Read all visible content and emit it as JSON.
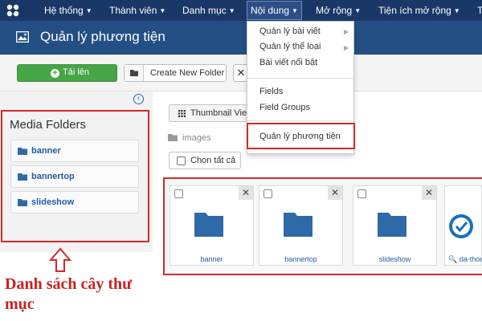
{
  "navbar": {
    "items": [
      {
        "label": "Hệ thống"
      },
      {
        "label": "Thành viên"
      },
      {
        "label": "Danh mục"
      },
      {
        "label": "Nội dung"
      },
      {
        "label": "Mở rộng"
      },
      {
        "label": "Tiện ích mở rộng"
      },
      {
        "label": "T"
      }
    ]
  },
  "header": {
    "title": "Quản lý phương tiện"
  },
  "toolbar": {
    "upload_label": "Tải lên",
    "new_folder_label": "Create New Folder"
  },
  "dropdown": {
    "items": [
      {
        "label": "Quản lý bài viết",
        "has_submenu": true
      },
      {
        "label": "Quản lý thể loại",
        "has_submenu": true
      },
      {
        "label": "Bài viết nổi bật",
        "has_submenu": false
      },
      {
        "label": "Fields",
        "has_submenu": false
      },
      {
        "label": "Field Groups",
        "has_submenu": false
      },
      {
        "label": "Quản lý phương tiện",
        "has_submenu": false
      }
    ]
  },
  "sidebar": {
    "title": "Media Folders",
    "folders": [
      {
        "label": "banner"
      },
      {
        "label": "bannertop"
      },
      {
        "label": "slideshow"
      }
    ]
  },
  "annotation": {
    "text": "Danh sách cây thư mục"
  },
  "main": {
    "view_label": "Thumbnail View",
    "breadcrumb": "images",
    "select_all_label": "Chọn tất cả",
    "thumbnails": [
      {
        "label": "banner",
        "type": "folder"
      },
      {
        "label": "bannertop",
        "type": "folder"
      },
      {
        "label": "slideshow",
        "type": "folder"
      },
      {
        "label": "da-thong",
        "type": "image"
      }
    ]
  },
  "colors": {
    "navbar": "#1a3867",
    "titlebar": "#244f85",
    "upload_button": "#46a546",
    "folder_icon": "#2e6aa8",
    "annotation_red": "#d32a2a"
  }
}
